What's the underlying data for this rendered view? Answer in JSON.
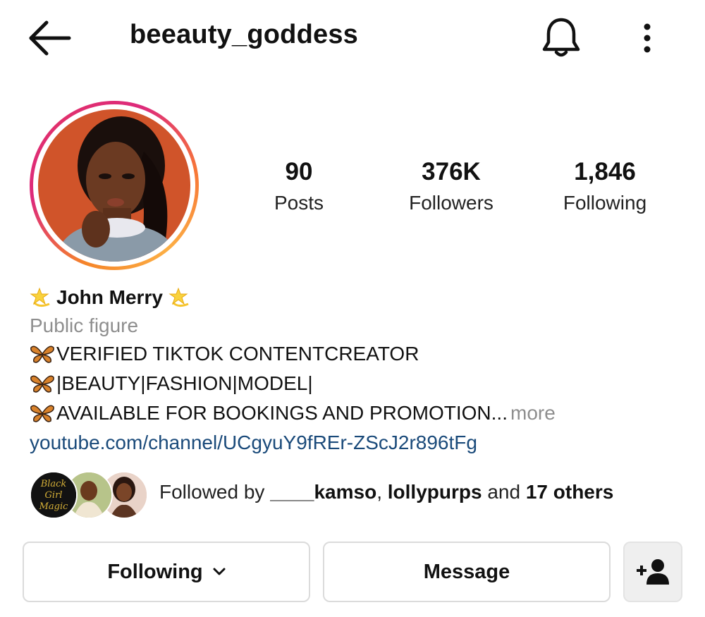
{
  "header": {
    "back_icon": "arrow-left-icon",
    "username": "beeauty_goddess",
    "notification_icon": "bell-icon",
    "more_icon": "more-vertical-icon"
  },
  "stats": [
    {
      "value": "90",
      "label": "Posts"
    },
    {
      "value": "376K",
      "label": "Followers"
    },
    {
      "value": "1,846",
      "label": "Following"
    }
  ],
  "bio": {
    "display_name": "John Merry",
    "name_emoji": "dizzy-star-emoji",
    "category": "Public figure",
    "lines": [
      "VERIFIED TIKTOK CONTENTCREATOR",
      "|BEAUTY|FASHION|MODEL|",
      "AVAILABLE FOR BOOKINGS AND PROMOTION"
    ],
    "line_emoji": "butterfly-emoji",
    "ellipsis": "...",
    "more_label": "more",
    "link": "youtube.com/channel/UCgyuY9fREr-ZScJ2r896tFg"
  },
  "followed_by": {
    "prefix": "Followed by",
    "user1": "____kamso",
    "separator": ",",
    "user2": "lollypurps",
    "conjunction": "and",
    "others": "17 others",
    "avatar1_text": "Black Girl Magic"
  },
  "actions": {
    "following_label": "Following",
    "message_label": "Message",
    "add_user_icon": "add-user-icon"
  },
  "colors": {
    "link": "#1a4a7a",
    "muted": "#8e8e8e",
    "button_border": "#dbdbdb"
  }
}
